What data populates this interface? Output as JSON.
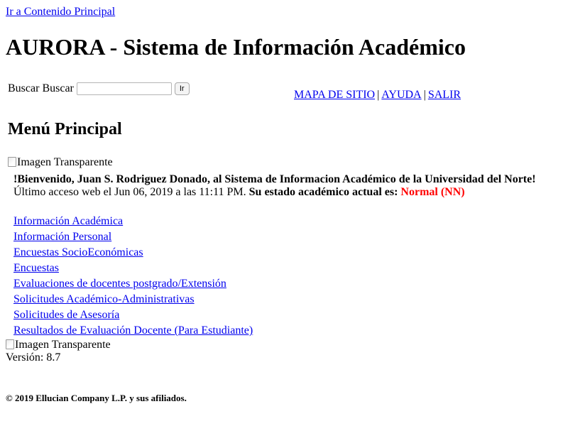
{
  "skip_link": "Ir a Contenido Principal",
  "app_title": "AURORA - Sistema de Información Académico",
  "search": {
    "label": "Buscar",
    "label_hidden": "Buscar",
    "value": "",
    "go_button": "Ir"
  },
  "top_nav": {
    "items": [
      "MAPA DE SITIO",
      "AYUDA",
      "SALIR"
    ],
    "separator": "|"
  },
  "menu_title": "Menú Principal",
  "image_alt": "Imagen Transparente",
  "welcome": {
    "greeting": "!Bienvenido, Juan S. Rodriguez Donado, al Sistema de Informacion Académico de la Universidad del Norte!",
    "last_access": "Último acceso web el Jun 06, 2019 a las 11:11 PM.",
    "status_label": "Su estado académico actual es:",
    "status_value": "Normal (NN)",
    "status_color": "#ff0000"
  },
  "main_links": [
    "Información Académica",
    "Información Personal",
    "Encuestas SocioEconómicas",
    "Encuestas",
    "Evaluaciones de docentes postgrado/Extensión",
    "Solicitudes Académico-Administrativas",
    "Solicitudes de Asesoría",
    "Resultados de Evaluación Docente (Para Estudiante)"
  ],
  "version": "Versión: 8.7",
  "copyright": "© 2019 Ellucian Company L.P. y sus afiliados.",
  "link_color": "#0000ee"
}
